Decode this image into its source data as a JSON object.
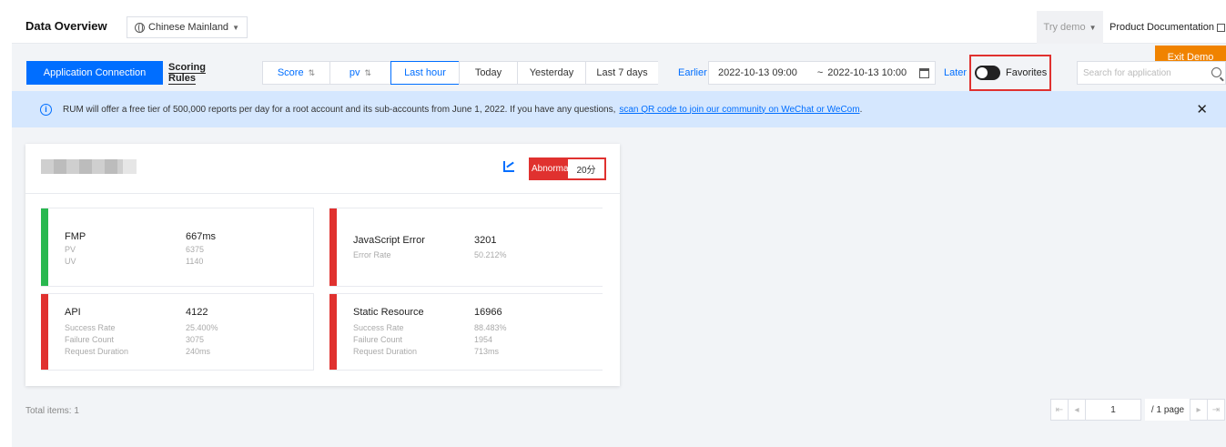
{
  "header": {
    "title": "Data Overview",
    "region": "Chinese Mainland",
    "try_demo": "Try demo",
    "product_docs": "Product Documentation",
    "exit_demo": "Exit Demo"
  },
  "toolbar": {
    "tab_active": "Application Connection",
    "tab_other": "Scoring Rules",
    "sort_score": "Score",
    "sort_pv": "pv",
    "time_ranges": [
      "Last hour",
      "Today",
      "Yesterday",
      "Last 7 days"
    ],
    "active_range": "Last hour",
    "earlier": "Earlier",
    "date_start": "2022-10-13 09:00",
    "date_sep": "~",
    "date_end": "2022-10-13 10:00",
    "later": "Later",
    "favorites_label": "Favorites",
    "favorites_on": false,
    "search_placeholder": "Search for application"
  },
  "notice": {
    "text": "RUM will offer a free tier of 500,000 reports per day for a root account and its sub-accounts from June 1, 2022. If you have any questions,",
    "link": "scan QR code to join our community on WeChat or WeCom",
    "end": "."
  },
  "card": {
    "badge_label": "Abnormal",
    "badge_score": "20分",
    "metrics": {
      "fmp": {
        "name": "FMP",
        "value": "667ms",
        "rows": [
          {
            "label": "PV",
            "value": "6375"
          },
          {
            "label": "UV",
            "value": "1140"
          }
        ]
      },
      "js": {
        "name": "JavaScript Error",
        "value": "3201",
        "rows": [
          {
            "label": "Error Rate",
            "value": "50.212%"
          }
        ]
      },
      "api": {
        "name": "API",
        "value": "4122",
        "rows": [
          {
            "label": "Success Rate",
            "value": "25.400%"
          },
          {
            "label": "Failure Count",
            "value": "3075"
          },
          {
            "label": "Request Duration",
            "value": "240ms"
          }
        ]
      },
      "static": {
        "name": "Static Resource",
        "value": "16966",
        "rows": [
          {
            "label": "Success Rate",
            "value": "88.483%"
          },
          {
            "label": "Failure Count",
            "value": "1954"
          },
          {
            "label": "Request Duration",
            "value": "713ms"
          }
        ]
      }
    }
  },
  "footer": {
    "total": "Total items: 1",
    "page_current": "1",
    "page_total": "/ 1 page"
  },
  "colors": {
    "primary": "#006eff",
    "danger": "#e0312f",
    "success": "#29b84f",
    "warning": "#f08300"
  }
}
